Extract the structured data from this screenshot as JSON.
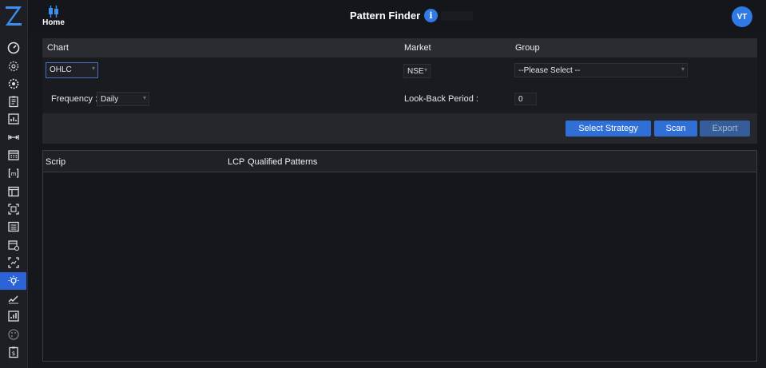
{
  "app": {
    "logo_icon": "z-logo-icon",
    "accent_color": "#2f7ae5"
  },
  "sidebar": {
    "items": [
      {
        "name": "dashboard-gauge-icon"
      },
      {
        "name": "settings-gear-icon"
      },
      {
        "name": "settings-cog-icon"
      },
      {
        "name": "clipboard-list-icon"
      },
      {
        "name": "chart-report-icon"
      },
      {
        "name": "range-arrows-icon"
      },
      {
        "name": "calendar-grid-icon"
      },
      {
        "name": "bracket-m-icon"
      },
      {
        "name": "window-panel-icon"
      },
      {
        "name": "scan-frame-icon"
      },
      {
        "name": "list-box-icon"
      },
      {
        "name": "calendar-settings-icon"
      },
      {
        "name": "scan-chart-icon"
      },
      {
        "name": "pattern-bulb-icon",
        "active": true
      },
      {
        "name": "trend-check-icon"
      },
      {
        "name": "chart-box-icon"
      },
      {
        "name": "palette-icon"
      },
      {
        "name": "clipboard-dollar-icon"
      }
    ]
  },
  "topbar": {
    "home_label": "Home",
    "title": "Pattern Finder",
    "info_label": "i",
    "avatar_initials": "VT"
  },
  "filters": {
    "chart_header": "Chart",
    "market_header": "Market",
    "group_header": "Group",
    "chart_value": "OHLC",
    "market_value": "NSE",
    "group_value": "--Please Select --",
    "frequency_label": "Frequency :",
    "frequency_value": "Daily",
    "lookback_label": "Look-Back Period :",
    "lookback_value": "0"
  },
  "actions": {
    "select_strategy_label": "Select Strategy",
    "scan_label": "Scan",
    "export_label": "Export"
  },
  "table": {
    "columns": [
      "Scrip",
      "LCP",
      "Qualified Patterns"
    ],
    "rows": []
  }
}
